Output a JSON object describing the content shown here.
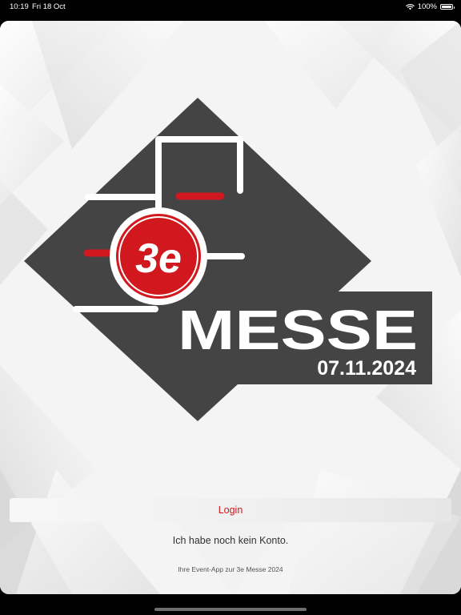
{
  "status_bar": {
    "time": "10:19",
    "date": "Fri 18 Oct",
    "battery": "100%",
    "wifi_icon": "wifi-icon",
    "battery_icon": "battery-full-icon"
  },
  "logo": {
    "badge_text": "3e",
    "title": "MESSE",
    "date": "07.11.2024",
    "colors": {
      "dark": "#444444",
      "brand_red": "#d0181e",
      "white": "#ffffff"
    }
  },
  "actions": {
    "login_label": "Login",
    "no_account_label": "Ich habe noch kein Konto."
  },
  "footer": {
    "tagline": "Ihre Event-App zur 3e Messe 2024"
  }
}
